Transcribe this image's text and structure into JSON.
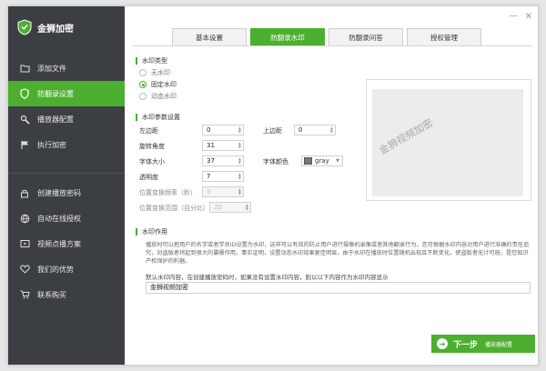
{
  "window": {
    "minimize_glyph": "—",
    "close_glyph": "✕"
  },
  "app": {
    "title": "金狮加密",
    "logo_icon": "shield-icon"
  },
  "sidebar": {
    "items": [
      {
        "label": "添加文件",
        "icon": "folder-icon",
        "active": false
      },
      {
        "label": "防翻录设置",
        "icon": "shield-icon",
        "active": true
      },
      {
        "label": "播放器配置",
        "icon": "wrench-icon",
        "active": false
      },
      {
        "label": "执行加密",
        "icon": "flag-icon",
        "active": false
      }
    ],
    "secondary": [
      {
        "label": "创建播放密码",
        "icon": "lock-icon"
      },
      {
        "label": "自动在线授权",
        "icon": "globe-icon"
      },
      {
        "label": "视频点播方案",
        "icon": "video-icon"
      },
      {
        "label": "我们的优势",
        "icon": "heart-icon"
      },
      {
        "label": "联系购买",
        "icon": "cart-icon"
      }
    ]
  },
  "tabs": [
    {
      "label": "基本设置",
      "active": false
    },
    {
      "label": "防翻录水印",
      "active": true
    },
    {
      "label": "防翻录问答",
      "active": false
    },
    {
      "label": "授权管理",
      "active": false
    }
  ],
  "watermark_type": {
    "title": "水印类型",
    "options": [
      {
        "label": "无水印",
        "checked": false
      },
      {
        "label": "固定水印",
        "checked": true
      },
      {
        "label": "动态水印",
        "checked": false
      }
    ]
  },
  "params": {
    "title": "水印参数设置",
    "left_margin": {
      "label": "左边距",
      "value": "0"
    },
    "top_margin": {
      "label": "上边距",
      "value": "0"
    },
    "rotation": {
      "label": "旋转角度",
      "value": "31"
    },
    "font_size": {
      "label": "字体大小",
      "value": "37"
    },
    "font_color": {
      "label": "字体颜色",
      "value": "gray",
      "swatch": "#777777"
    },
    "opacity": {
      "label": "透明度",
      "value": "7"
    },
    "move_freq": {
      "label": "位置变换频率（秒）",
      "value": "3"
    },
    "move_range": {
      "label": "位置变换范围（百分比）",
      "value": "20"
    }
  },
  "preview": {
    "watermark_text": "金狮视频加密"
  },
  "usage": {
    "title": "水印作用",
    "description": "播放时可以把用户的名字或者学员ID设置为水印，这样可以有效的防止用户进行摄像机录像或者其他翻录行为，您可根据水印内容对用户进行准确的责任追究，对盗版者将起到很大的震慑作用。事实证明，设置动态水印效果更佳明显，由于水印在播放时位置随机出现且不断变化，使盗版者无计可施，是您知识产权保护的利器。",
    "default_label": "默认水印内容，在创建播放密码时，如果没有设置水印内容，则以以下内容作为水印内容显示",
    "default_value": "金狮视频加密"
  },
  "next_button": {
    "label": "下一步",
    "sub": "播放器配置"
  },
  "colors": {
    "accent": "#4caf30",
    "sidebar_bg": "#3b3f43"
  }
}
